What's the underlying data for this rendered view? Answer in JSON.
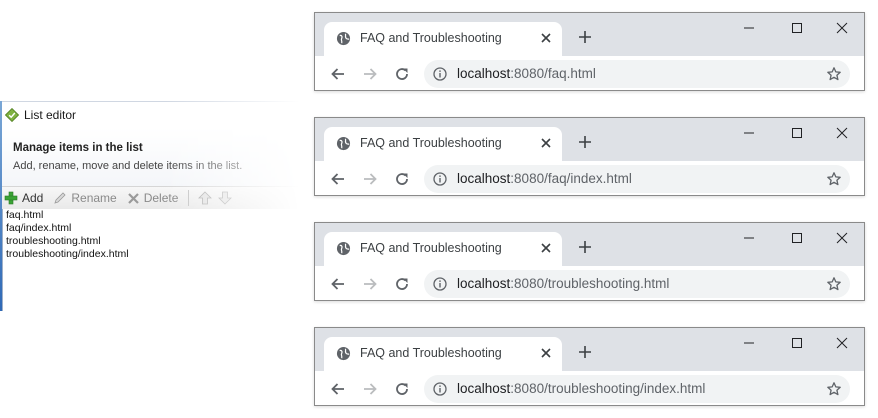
{
  "list_editor": {
    "title": "List editor",
    "heading": "Manage items in the list",
    "description": "Add, rename, move and delete items in the list.",
    "toolbar": {
      "add_label": "Add",
      "rename_label": "Rename",
      "delete_label": "Delete"
    },
    "items": [
      "faq.html",
      "faq/index.html",
      "troubleshooting.html",
      "troubleshooting/index.html"
    ]
  },
  "browsers": [
    {
      "tab_title": "FAQ and Troubleshooting",
      "url_host": "localhost",
      "url_rest": ":8080/faq.html"
    },
    {
      "tab_title": "FAQ and Troubleshooting",
      "url_host": "localhost",
      "url_rest": ":8080/faq/index.html"
    },
    {
      "tab_title": "FAQ and Troubleshooting",
      "url_host": "localhost",
      "url_rest": ":8080/troubleshooting.html"
    },
    {
      "tab_title": "FAQ and Troubleshooting",
      "url_host": "localhost",
      "url_rest": ":8080/troubleshooting/index.html"
    }
  ],
  "colors": {
    "tabstrip": "#dee1e6",
    "omnibox": "#f1f3f4",
    "add_green": "#3aa335",
    "app_icon_green": "#7fb241"
  }
}
